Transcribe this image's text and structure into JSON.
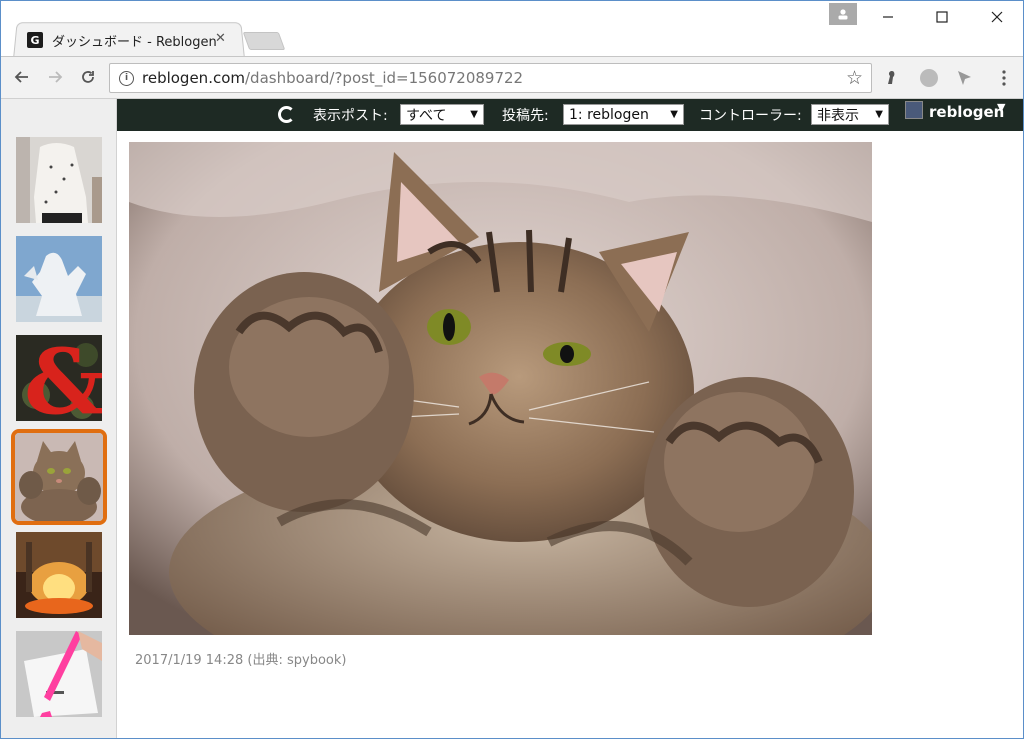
{
  "window": {
    "tab_title": "ダッシュボード - Reblogen",
    "favicon_letter": "G"
  },
  "toolbar": {
    "url_host": "reblogen.com",
    "url_path": "/dashboard/?post_id=156072089722"
  },
  "topbar": {
    "display_post_label": "表示ポスト:",
    "display_post_value": "すべて",
    "post_to_label": "投稿先:",
    "post_to_value": "1: reblogen",
    "controller_label": "コントローラー:",
    "controller_value": "非表示",
    "username": "reblogen"
  },
  "sidebar": {
    "thumbnails": [
      {
        "name": "thumb-fashion-woman",
        "active": false
      },
      {
        "name": "thumb-statue",
        "active": false
      },
      {
        "name": "thumb-ampersand",
        "active": false
      },
      {
        "name": "thumb-cat",
        "active": true
      },
      {
        "name": "thumb-fire",
        "active": false
      },
      {
        "name": "thumb-highlighter",
        "active": false
      }
    ]
  },
  "post": {
    "caption": "2017/1/19 14:28 (出典: spybook)"
  },
  "colors": {
    "topbar_bg": "#1e2a24",
    "active_thumb_border": "#e06e10",
    "sidebar_bg": "#eeeeee"
  }
}
